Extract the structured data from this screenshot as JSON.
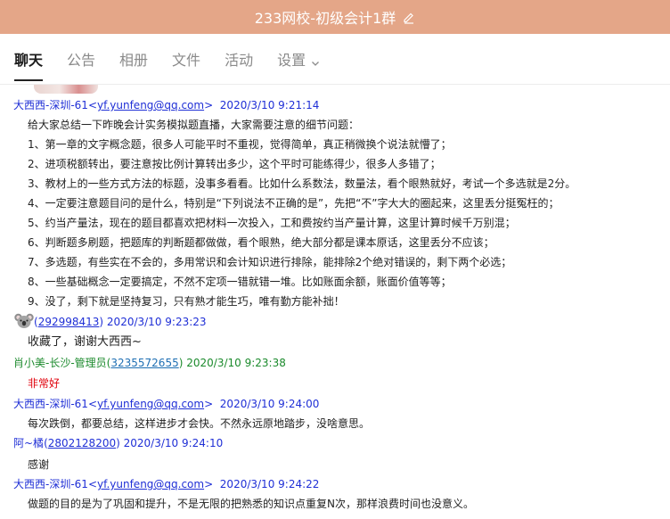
{
  "window": {
    "title": "233网校-初级会计1群"
  },
  "tabs": [
    {
      "label": "聊天"
    },
    {
      "label": "公告"
    },
    {
      "label": "相册"
    },
    {
      "label": "文件"
    },
    {
      "label": "活动"
    },
    {
      "label": "设置"
    }
  ],
  "messages": [
    {
      "sender": "大西西-深圳-61",
      "email": "yf.yunfeng@qq.com",
      "time": "2020/3/10 9:21:14",
      "lines": [
        "给大家总结一下昨晚会计实务模拟题直播，大家需要注意的细节问题：",
        "1、第一章的文字概念题，很多人可能平时不重视，觉得简单，真正稍微换个说法就懵了；",
        "2、进项税额转出，要注意按比例计算转出多少，这个平时可能练得少，很多人多错了；",
        "3、教材上的一些方式方法的标题，没事多看看。比如什么系数法，数量法，看个眼熟就好，考试一个多选就是2分。",
        "4、一定要注意题目问的是什么，特别是“下列说法不正确的是”，先把“不”字大大的圈起来，这里丢分挺冤枉的；",
        "5、约当产量法，现在的题目都喜欢把材料一次投入，工和费按约当产量计算，这里计算时候千万别混；",
        "6、判断题多刷题，把题库的判断题都做做，看个眼熟，绝大部分都是课本原话，这里丢分不应该；",
        "7、多选题，有些实在不会的，多用常识和会计知识进行排除，能排除2个绝对错误的，剩下两个必选；",
        "8、一些基础概念一定要搞定，不然不定项一错就错一堆。比如账面余额，账面价值等等；",
        "9、没了，剩下就是坚持复习，只有熟才能生巧，唯有勤方能补拙！"
      ]
    },
    {
      "qq": "292998413",
      "time": "2020/3/10 9:23:23",
      "lines": [
        "收藏了，谢谢大西西~"
      ]
    },
    {
      "sender": "肖小美-长沙-管理员",
      "qq": "3235572655",
      "time": "2020/3/10 9:23:38",
      "lines": [
        "非常好"
      ]
    },
    {
      "sender": "大西西-深圳-61",
      "email": "yf.yunfeng@qq.com",
      "time": "2020/3/10 9:24:00",
      "lines": [
        "每次跌倒，都要总结，这样进步才会快。不然永远原地踏步，没啥意思。"
      ]
    },
    {
      "sender": "阿~橘",
      "qq": "2802128200",
      "time": "2020/3/10 9:24:10",
      "lines": [
        "感谢"
      ]
    },
    {
      "sender": "大西西-深圳-61",
      "email": "yf.yunfeng@qq.com",
      "time": "2020/3/10 9:24:22",
      "lines": [
        "做题的目的是为了巩固和提升，不是无限的把熟悉的知识点重复N次，那样浪费时间也没意义。"
      ]
    }
  ],
  "colors": {
    "titlebar": "#e4a688",
    "name_blue": "#1f2fd6",
    "name_green": "#1b8a2c",
    "red_text": "#e0000b"
  },
  "icons": {
    "title_edit": "edit-icon",
    "settings_dropdown": "chevron-down-icon",
    "avatar": "koala-avatar"
  }
}
